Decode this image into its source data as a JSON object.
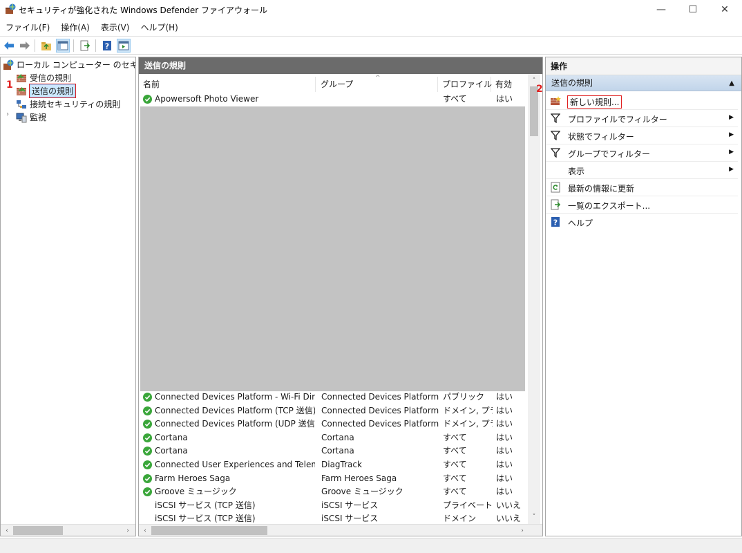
{
  "window": {
    "title": "セキュリティが強化された Windows Defender ファイアウォール",
    "minimize": "—",
    "maximize": "☐",
    "close": "✕"
  },
  "menu": [
    "ファイル(F)",
    "操作(A)",
    "表示(V)",
    "ヘルプ(H)"
  ],
  "toolbar": {
    "icons": [
      "back-arrow-icon",
      "forward-arrow-icon",
      "up-folder-icon",
      "show-hide-tree-icon",
      "export-list-icon",
      "help-icon",
      "show-hide-action-pane-icon"
    ]
  },
  "tree": {
    "root": "ローカル コンピューター のセキュリティカ",
    "inbound": "受信の規則",
    "outbound": "送信の規則",
    "connection_security": "接続セキュリティの規則",
    "monitoring": "監視",
    "expander": "›"
  },
  "center": {
    "header": "送信の規則",
    "columns": [
      "名前",
      "グループ",
      "プロファイル",
      "有効"
    ],
    "sort_indicator": "^",
    "top_row": {
      "name": "Apowersoft Photo Viewer",
      "group": "",
      "profile": "すべて",
      "enabled": "はい",
      "checked": true
    },
    "rows": [
      {
        "name": "Connected Devices Platform - Wi-Fi Direct...",
        "group": "Connected Devices Platform",
        "profile": "パブリック",
        "enabled": "はい",
        "checked": true
      },
      {
        "name": "Connected Devices Platform (TCP 送信)",
        "group": "Connected Devices Platform",
        "profile": "ドメイン, プラ...",
        "enabled": "はい",
        "checked": true
      },
      {
        "name": "Connected Devices Platform (UDP 送信)",
        "group": "Connected Devices Platform",
        "profile": "ドメイン, プラ...",
        "enabled": "はい",
        "checked": true
      },
      {
        "name": "Cortana",
        "group": "Cortana",
        "profile": "すべて",
        "enabled": "はい",
        "checked": true
      },
      {
        "name": "Cortana",
        "group": "Cortana",
        "profile": "すべて",
        "enabled": "はい",
        "checked": true
      },
      {
        "name": "Connected User Experiences and Telemetry",
        "group": "DiagTrack",
        "profile": "すべて",
        "enabled": "はい",
        "checked": true
      },
      {
        "name": "Farm Heroes Saga",
        "group": "Farm Heroes Saga",
        "profile": "すべて",
        "enabled": "はい",
        "checked": true
      },
      {
        "name": "Groove ミュージック",
        "group": "Groove ミュージック",
        "profile": "すべて",
        "enabled": "はい",
        "checked": true
      },
      {
        "name": "iSCSI サービス (TCP 送信)",
        "group": "iSCSI サービス",
        "profile": "プライベート, ...",
        "enabled": "いいえ",
        "checked": false
      },
      {
        "name": "iSCSI サービス (TCP 送信)",
        "group": "iSCSI サービス",
        "profile": "ドメイン",
        "enabled": "いいえ",
        "checked": false
      }
    ]
  },
  "actions": {
    "title": "操作",
    "section": "送信の規則",
    "collapse": "▲",
    "items": [
      {
        "label": "新しい規則...",
        "icon": "new-rule-icon"
      },
      {
        "label": "プロファイルでフィルター",
        "icon": "filter-icon",
        "submenu": "▶"
      },
      {
        "label": "状態でフィルター",
        "icon": "filter-icon",
        "submenu": "▶"
      },
      {
        "label": "グループでフィルター",
        "icon": "filter-icon",
        "submenu": "▶"
      },
      {
        "label": "表示",
        "icon": "",
        "submenu": "▶"
      },
      {
        "label": "最新の情報に更新",
        "icon": "refresh-icon"
      },
      {
        "label": "一覧のエクスポート...",
        "icon": "export-icon"
      },
      {
        "label": "ヘルプ",
        "icon": "help-icon"
      }
    ]
  },
  "callouts": [
    "1",
    "2"
  ],
  "scroll": {
    "left": "‹",
    "right": "›",
    "up": "˄",
    "down": "˅"
  },
  "colors": {
    "accent_red": "#e02020",
    "header_gray": "#6b6b6b",
    "check_green": "#3aa63a",
    "selection_blue": "#cce8ff"
  }
}
